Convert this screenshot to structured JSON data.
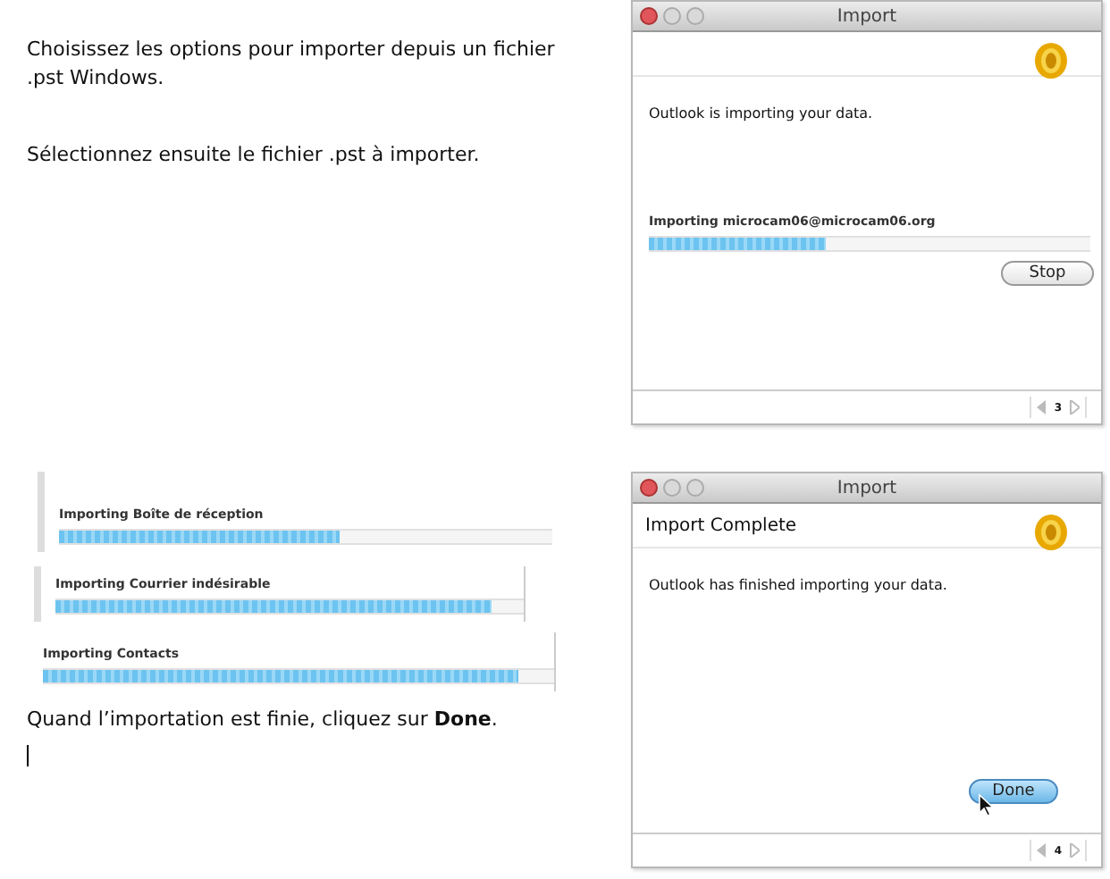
{
  "top_paragraphs": [
    "Choisissez les options pour importer depuis un fichier .pst Windows.",
    "Sélectionnez ensuite le fichier .pst à importer."
  ],
  "dialogs": [
    {
      "title": "Import",
      "message": "Outlook is importing your data.",
      "progress": {
        "label": "Importing microcam06@microcam06.org",
        "level": 0.4
      },
      "button": {
        "label": "Stop",
        "default": false
      },
      "page": "3"
    },
    {
      "title": "Import",
      "heading": "Import Complete",
      "message": "Outlook has finished importing your data.",
      "button": {
        "label": "Done",
        "default": true
      },
      "page": "4"
    }
  ],
  "progress_snippets": [
    {
      "label": "Importing Boîte de réception",
      "level": 0.57
    },
    {
      "label": "Importing Courrier indésirable",
      "level": 0.93
    },
    {
      "label": "Importing Contacts",
      "level": 0.93
    }
  ],
  "bottom_paragraph": "Quand l’importation est finie, cliquez sur **Done**."
}
